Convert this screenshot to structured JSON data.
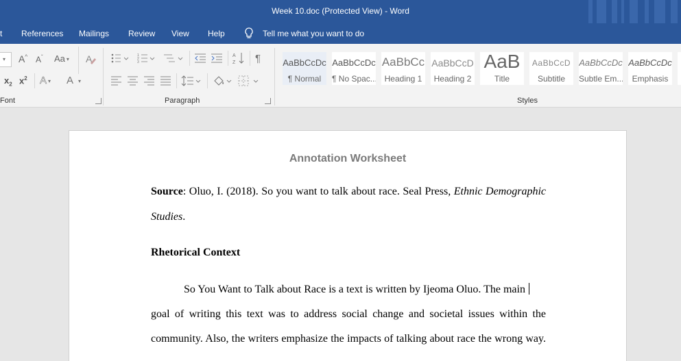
{
  "window": {
    "title": "Week 10.doc (Protected View)  -  Word"
  },
  "tabs": [
    {
      "label": "t"
    },
    {
      "label": "References"
    },
    {
      "label": "Mailings"
    },
    {
      "label": "Review"
    },
    {
      "label": "View"
    },
    {
      "label": "Help"
    }
  ],
  "tell_me": {
    "label": "Tell me what you want to do",
    "icon": "lightbulb-icon"
  },
  "ribbon": {
    "font_group": {
      "label": "Font",
      "grow_label": "A",
      "shrink_label": "A",
      "case_label": "Aa",
      "subscript_label": "x",
      "subscript_mark": "2",
      "superscript_label": "x",
      "superscript_mark": "2",
      "text_effects_label": "A",
      "font_color_label": "A"
    },
    "paragraph_group": {
      "label": "Paragraph",
      "show_marks_label": "¶"
    },
    "styles_group": {
      "label": "Styles",
      "items": [
        {
          "sample": "AaBbCcDc",
          "name": "¶ Normal"
        },
        {
          "sample": "AaBbCcDc",
          "name": "¶ No Spac..."
        },
        {
          "sample": "AaBbCc",
          "name": "Heading 1"
        },
        {
          "sample": "AaBbCcD",
          "name": "Heading 2"
        },
        {
          "sample": "AaB",
          "name": "Title"
        },
        {
          "sample": "AaBbCcD",
          "name": "Subtitle"
        },
        {
          "sample": "AaBbCcDc",
          "name": "Subtle Em..."
        },
        {
          "sample": "AaBbCcDc",
          "name": "Emphasis"
        }
      ]
    }
  },
  "document": {
    "title": "Annotation Worksheet",
    "source_label": "Source",
    "source_text": ": Oluo, I. (2018). So you want to talk about race. Seal Press, ",
    "source_italic_1": "Ethnic Demographic",
    "source_italic_2": "Studies",
    "source_end": ".",
    "heading": "Rhetorical Context",
    "para_line_1": "So You Want to Talk about Race is a text is written by Ijeoma Oluo. The main",
    "para_line_2": "goal of writing this text was to address social change and societal issues within the",
    "para_line_3": "community. Also, the writers emphasize the impacts of talking about race the wrong way."
  },
  "colors": {
    "titlebar": "#2b579a",
    "ribbon": "#f3f3f3",
    "canvas": "#e6e6e6",
    "page": "#ffffff"
  }
}
